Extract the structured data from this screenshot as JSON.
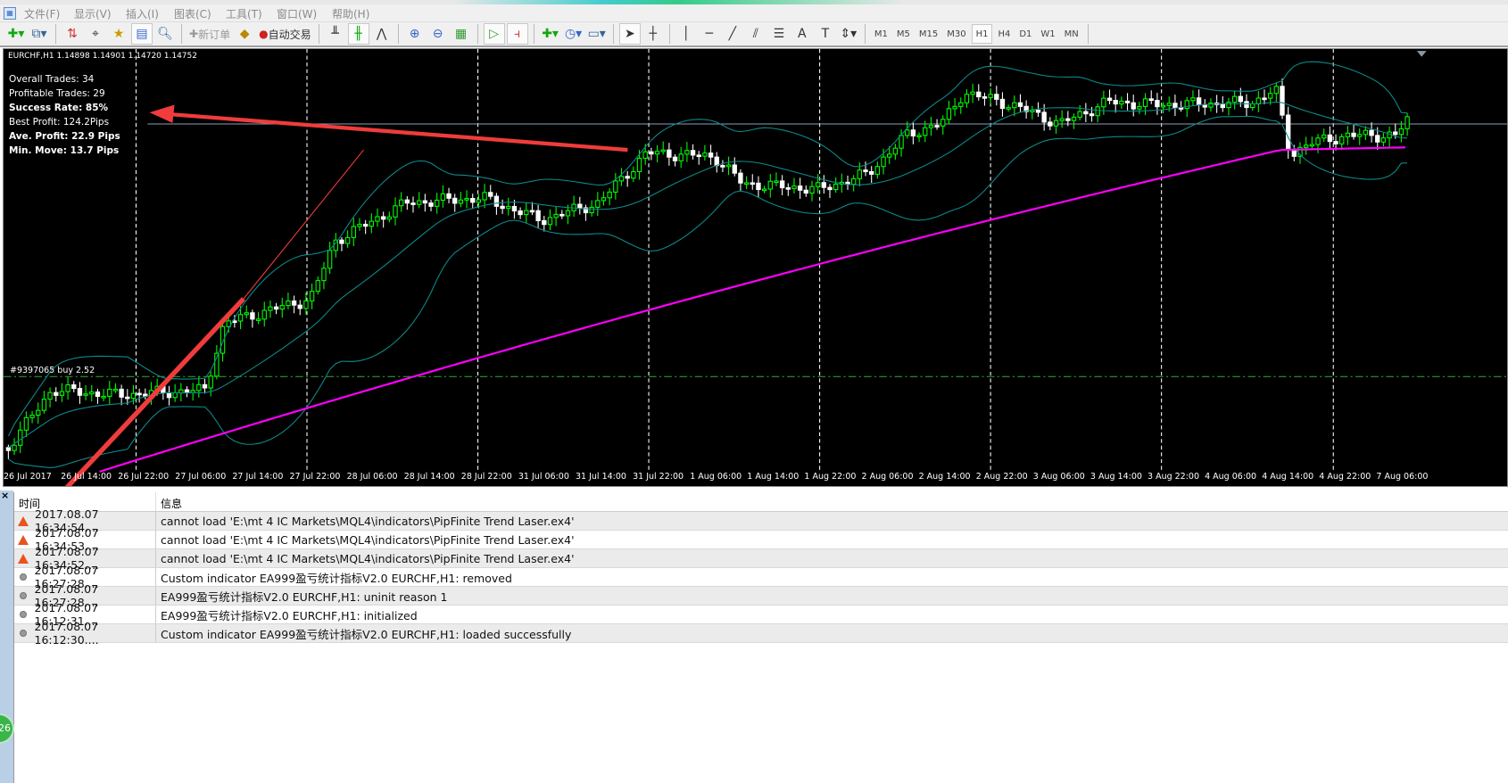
{
  "menu": [
    "文件(F)",
    "显示(V)",
    "插入(I)",
    "图表(C)",
    "工具(T)",
    "窗口(W)",
    "帮助(H)"
  ],
  "toolbar": {
    "new_order": "新订单",
    "auto_trading": "自动交易",
    "timeframes": [
      "M1",
      "M5",
      "M15",
      "M30",
      "H1",
      "H4",
      "D1",
      "W1",
      "MN"
    ],
    "active_timeframe": "H1"
  },
  "chart": {
    "symbol_line": "EURCHF,H1  1.14898 1.14901 1.14720 1.14752",
    "stats": {
      "overall": "Overall Trades: 34",
      "profitable": "Profitable Trades: 29",
      "success": "Success Rate: 85%",
      "best": "Best Profit: 124.2Pips",
      "ave": "Ave. Profit: 22.9 Pips",
      "min": "Min. Move: 13.7 Pips"
    },
    "order_label": "#9397065 buy 2.52",
    "x_labels": [
      "26 Jul 2017",
      "26 Jul 14:00",
      "26 Jul 22:00",
      "27 Jul 06:00",
      "27 Jul 14:00",
      "27 Jul 22:00",
      "28 Jul 06:00",
      "28 Jul 14:00",
      "28 Jul 22:00",
      "31 Jul 06:00",
      "31 Jul 14:00",
      "31 Jul 22:00",
      "1 Aug 06:00",
      "1 Aug 14:00",
      "1 Aug 22:00",
      "2 Aug 06:00",
      "2 Aug 14:00",
      "2 Aug 22:00",
      "3 Aug 06:00",
      "3 Aug 14:00",
      "3 Aug 22:00",
      "4 Aug 06:00",
      "4 Aug 14:00",
      "4 Aug 22:00",
      "7 Aug 06:00"
    ],
    "colors": {
      "bull": "#00ff00",
      "bear": "#ffffff",
      "bands": "#0e8a8a",
      "ma": "#ff00ff",
      "arrow": "#f03c3c"
    }
  },
  "log": {
    "headers": {
      "time": "时间",
      "message": "信息"
    },
    "rows": [
      {
        "icon": "warning",
        "time": "2017.08.07 16:34:54....",
        "message": "cannot load 'E:\\mt 4 IC Markets\\MQL4\\indicators\\PipFinite Trend Laser.ex4'"
      },
      {
        "icon": "warning",
        "time": "2017.08.07 16:34:53....",
        "message": "cannot load 'E:\\mt 4 IC Markets\\MQL4\\indicators\\PipFinite Trend Laser.ex4'"
      },
      {
        "icon": "warning",
        "time": "2017.08.07 16:34:52....",
        "message": "cannot load 'E:\\mt 4 IC Markets\\MQL4\\indicators\\PipFinite Trend Laser.ex4'"
      },
      {
        "icon": "info",
        "time": "2017.08.07 16:27:28....",
        "message": "Custom indicator EA999盈亏统计指标V2.0 EURCHF,H1: removed"
      },
      {
        "icon": "info",
        "time": "2017.08.07 16:27:28....",
        "message": "EA999盈亏统计指标V2.0 EURCHF,H1: uninit reason 1"
      },
      {
        "icon": "info",
        "time": "2017.08.07 16:12:31....",
        "message": "EA999盈亏统计指标V2.0 EURCHF,H1: initialized"
      },
      {
        "icon": "info",
        "time": "2017.08.07 16:12:30....",
        "message": "Custom indicator EA999盈亏统计指标V2.0 EURCHF,H1: loaded successfully"
      }
    ]
  },
  "badge": "26"
}
